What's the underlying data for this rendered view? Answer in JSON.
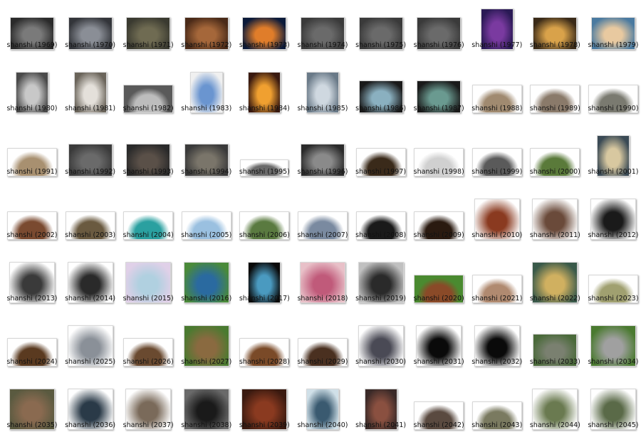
{
  "items": [
    {
      "label": "shanshi (1969)",
      "icon": "dark-rock-thumbnail-icon",
      "colors": [
        "#7a7a7a",
        "#2a2a2a"
      ],
      "shape": "landscape"
    },
    {
      "label": "shanshi (1970)",
      "icon": "crystal-rocks-thumbnail-icon",
      "colors": [
        "#8a8e96",
        "#33353a"
      ],
      "shape": "landscape"
    },
    {
      "label": "shanshi (1971)",
      "icon": "mossy-rock-thumbnail-icon",
      "colors": [
        "#6f6b52",
        "#3a3a30"
      ],
      "shape": "landscape"
    },
    {
      "label": "shanshi (1972)",
      "icon": "red-cliff-thumbnail-icon",
      "colors": [
        "#a5673a",
        "#4a2a18"
      ],
      "shape": "landscape"
    },
    {
      "label": "shanshi (1973)",
      "icon": "glowing-rock-thumbnail-icon",
      "colors": [
        "#e07d2a",
        "#0b1a3a"
      ],
      "shape": "landscape"
    },
    {
      "label": "shanshi (1974)",
      "icon": "grey-stones-thumbnail-icon",
      "colors": [
        "#6a6a6a",
        "#3a3a3a"
      ],
      "shape": "landscape"
    },
    {
      "label": "shanshi (1975)",
      "icon": "grey-stones-thumbnail-icon",
      "colors": [
        "#6a6a6a",
        "#3a3a3a"
      ],
      "shape": "landscape"
    },
    {
      "label": "shanshi (1976)",
      "icon": "grey-stones-thumbnail-icon",
      "colors": [
        "#6a6a6a",
        "#3a3a3a"
      ],
      "shape": "landscape"
    },
    {
      "label": "shanshi (1977)",
      "icon": "purple-cave-thumbnail-icon",
      "colors": [
        "#7a3aa0",
        "#2a1a55"
      ],
      "shape": "portrait"
    },
    {
      "label": "shanshi (1978)",
      "icon": "golden-cave-thumbnail-icon",
      "colors": [
        "#d9a24a",
        "#3a2a18"
      ],
      "shape": "landscape"
    },
    {
      "label": "shanshi (1979)",
      "icon": "coast-rock-thumbnail-icon",
      "colors": [
        "#e8c9a0",
        "#4a7aa0"
      ],
      "shape": "landscape"
    },
    {
      "label": "shanshi (1980)",
      "icon": "misty-peak-thumbnail-icon",
      "colors": [
        "#c8c8c8",
        "#4a4a4a"
      ],
      "shape": "portrait"
    },
    {
      "label": "shanshi (1981)",
      "icon": "misty-peak-thumbnail-icon",
      "colors": [
        "#e4e0da",
        "#6a645a"
      ],
      "shape": "portrait"
    },
    {
      "label": "shanshi (1982)",
      "icon": "white-rock-thumbnail-icon",
      "colors": [
        "#bdbdbd",
        "#5a5a5a"
      ],
      "shape": "cutout"
    },
    {
      "label": "shanshi (1983)",
      "icon": "snow-spire-thumbnail-icon",
      "colors": [
        "#6a95d0",
        "#f0f0f0"
      ],
      "shape": "portrait"
    },
    {
      "label": "shanshi (1984)",
      "icon": "sunset-cliff-thumbnail-icon",
      "colors": [
        "#f0a030",
        "#3a1a10"
      ],
      "shape": "portrait"
    },
    {
      "label": "shanshi (1985)",
      "icon": "sea-cliff-thumbnail-icon",
      "colors": [
        "#cfd8e0",
        "#6a7a88"
      ],
      "shape": "portrait"
    },
    {
      "label": "shanshi (1986)",
      "icon": "blue-boulder-thumbnail-icon",
      "colors": [
        "#8ab0c0",
        "#1a1a1a"
      ],
      "shape": "landscape"
    },
    {
      "label": "shanshi (1987)",
      "icon": "teal-boulder-thumbnail-icon",
      "colors": [
        "#6a9a90",
        "#1a1a1a"
      ],
      "shape": "landscape"
    },
    {
      "label": "shanshi (1988)",
      "icon": "flat-rock-thumbnail-icon",
      "colors": [
        "#a08a70",
        "#ffffff"
      ],
      "shape": "cutout"
    },
    {
      "label": "shanshi (1989)",
      "icon": "flat-rock-thumbnail-icon",
      "colors": [
        "#8a7a6a",
        "#ffffff"
      ],
      "shape": "cutout"
    },
    {
      "label": "shanshi (1990)",
      "icon": "flat-rock-thumbnail-icon",
      "colors": [
        "#7a7a70",
        "#ffffff"
      ],
      "shape": "cutout"
    },
    {
      "label": "shanshi (1991)",
      "icon": "layered-rock-thumbnail-icon",
      "colors": [
        "#a89070",
        "#ffffff"
      ],
      "shape": "cutout"
    },
    {
      "label": "shanshi (1992)",
      "icon": "grey-arch-thumbnail-icon",
      "colors": [
        "#6a6a6a",
        "#3a3a3a"
      ],
      "shape": "landscape"
    },
    {
      "label": "shanshi (1993)",
      "icon": "stone-pillar-thumbnail-icon",
      "colors": [
        "#5a5048",
        "#2a2a2a"
      ],
      "shape": "landscape"
    },
    {
      "label": "shanshi (1994)",
      "icon": "stone-pillar-thumbnail-icon",
      "colors": [
        "#7a756a",
        "#3a3a3a"
      ],
      "shape": "landscape"
    },
    {
      "label": "shanshi (1995)",
      "icon": "pebble-row-thumbnail-icon",
      "colors": [
        "#6a6a6a",
        "#ffffff"
      ],
      "shape": "strip"
    },
    {
      "label": "shanshi (1996)",
      "icon": "grey-boulders-thumbnail-icon",
      "colors": [
        "#8a8a8a",
        "#2a2a2a"
      ],
      "shape": "landscape"
    },
    {
      "label": "shanshi (1997)",
      "icon": "cliff-edge-thumbnail-icon",
      "colors": [
        "#3a2a1a",
        "#ffffff"
      ],
      "shape": "cutout"
    },
    {
      "label": "shanshi (1998)",
      "icon": "white-pebbles-thumbnail-icon",
      "colors": [
        "#d0d0d0",
        "#ffffff"
      ],
      "shape": "cutout"
    },
    {
      "label": "shanshi (1999)",
      "icon": "small-rock-thumbnail-icon",
      "colors": [
        "#5a5a5a",
        "#ffffff"
      ],
      "shape": "cutout"
    },
    {
      "label": "shanshi (2000)",
      "icon": "grass-rock-thumbnail-icon",
      "colors": [
        "#5a7a3a",
        "#ffffff"
      ],
      "shape": "cutout"
    },
    {
      "label": "shanshi (2001)",
      "icon": "lake-rock-thumbnail-icon",
      "colors": [
        "#d8c8a0",
        "#3a4a55"
      ],
      "shape": "portrait"
    },
    {
      "label": "shanshi (2002)",
      "icon": "spiky-ridge-thumbnail-icon",
      "colors": [
        "#7a4a30",
        "#ffffff"
      ],
      "shape": "cutout"
    },
    {
      "label": "shanshi (2003)",
      "icon": "earth-bank-thumbnail-icon",
      "colors": [
        "#6a5a40",
        "#ffffff"
      ],
      "shape": "cutout"
    },
    {
      "label": "shanshi (2004)",
      "icon": "pond-rock-thumbnail-icon",
      "colors": [
        "#2aa0a0",
        "#ffffff"
      ],
      "shape": "cutout"
    },
    {
      "label": "shanshi (2005)",
      "icon": "smooth-stones-thumbnail-icon",
      "colors": [
        "#9ac0e0",
        "#ffffff"
      ],
      "shape": "cutout"
    },
    {
      "label": "shanshi (2006)",
      "icon": "green-hill-thumbnail-icon",
      "colors": [
        "#5a7a40",
        "#ffffff"
      ],
      "shape": "cutout"
    },
    {
      "label": "shanshi (2007)",
      "icon": "mountain-range-thumbnail-icon",
      "colors": [
        "#7a8aa0",
        "#ffffff"
      ],
      "shape": "cutout"
    },
    {
      "label": "shanshi (2008)",
      "icon": "dark-silhouette-thumbnail-icon",
      "colors": [
        "#1a1a1a",
        "#ffffff"
      ],
      "shape": "cutout"
    },
    {
      "label": "shanshi (2009)",
      "icon": "dark-silhouette-thumbnail-icon",
      "colors": [
        "#2a1a10",
        "#ffffff"
      ],
      "shape": "cutout"
    },
    {
      "label": "shanshi (2010)",
      "icon": "flying-debris-thumbnail-icon",
      "colors": [
        "#8a3a20",
        "#ffffff"
      ],
      "shape": "square"
    },
    {
      "label": "shanshi (2011)",
      "icon": "flying-debris-thumbnail-icon",
      "colors": [
        "#6a4a3a",
        "#ffffff"
      ],
      "shape": "square"
    },
    {
      "label": "shanshi (2012)",
      "icon": "flying-debris-thumbnail-icon",
      "colors": [
        "#1a1a1a",
        "#ffffff"
      ],
      "shape": "square"
    },
    {
      "label": "shanshi (2013)",
      "icon": "flying-debris-thumbnail-icon",
      "colors": [
        "#3a3a3a",
        "#ffffff"
      ],
      "shape": "square"
    },
    {
      "label": "shanshi (2014)",
      "icon": "flying-debris-thumbnail-icon",
      "colors": [
        "#2a2a2a",
        "#ffffff"
      ],
      "shape": "square"
    },
    {
      "label": "shanshi (2015)",
      "icon": "opal-gem-thumbnail-icon",
      "colors": [
        "#b0d0e0",
        "#e0d0e8"
      ],
      "shape": "square"
    },
    {
      "label": "shanshi (2016)",
      "icon": "blue-crystal-thumbnail-icon",
      "colors": [
        "#2a6aa0",
        "#4a8a3a"
      ],
      "shape": "square"
    },
    {
      "label": "shanshi (2017)",
      "icon": "earth-stone-thumbnail-icon",
      "colors": [
        "#4a9ac0",
        "#0a0a0a"
      ],
      "shape": "portrait"
    },
    {
      "label": "shanshi (2018)",
      "icon": "pink-sphere-thumbnail-icon",
      "colors": [
        "#c05a7a",
        "#e8c0c8"
      ],
      "shape": "square"
    },
    {
      "label": "shanshi (2019)",
      "icon": "black-sphere-thumbnail-icon",
      "colors": [
        "#2a2a2a",
        "#c0c0c0"
      ],
      "shape": "square"
    },
    {
      "label": "shanshi (2020)",
      "icon": "floating-island-thumbnail-icon",
      "colors": [
        "#8a4a28",
        "#4a8a30"
      ],
      "shape": "cutout"
    },
    {
      "label": "shanshi (2021)",
      "icon": "rock-ledge-thumbnail-icon",
      "colors": [
        "#b08a70",
        "#ffffff"
      ],
      "shape": "cutout"
    },
    {
      "label": "shanshi (2022)",
      "icon": "sky-rock-thumbnail-icon",
      "colors": [
        "#d0b060",
        "#3a5a4a"
      ],
      "shape": "square"
    },
    {
      "label": "shanshi (2023)",
      "icon": "moss-stone-thumbnail-icon",
      "colors": [
        "#a0a070",
        "#ffffff"
      ],
      "shape": "cutout"
    },
    {
      "label": "shanshi (2024)",
      "icon": "driftwood-rock-thumbnail-icon",
      "colors": [
        "#5a3a20",
        "#ffffff"
      ],
      "shape": "cutout"
    },
    {
      "label": "shanshi (2025)",
      "icon": "grey-boulder-thumbnail-icon",
      "colors": [
        "#8a9098",
        "#ffffff"
      ],
      "shape": "square"
    },
    {
      "label": "shanshi (2026)",
      "icon": "cliff-edge-thumbnail-icon",
      "colors": [
        "#6a4a30",
        "#ffffff"
      ],
      "shape": "cutout"
    },
    {
      "label": "shanshi (2027)",
      "icon": "tree-rock-thumbnail-icon",
      "colors": [
        "#8a6a40",
        "#4a7a30"
      ],
      "shape": "square"
    },
    {
      "label": "shanshi (2028)",
      "icon": "rock-arch-thumbnail-icon",
      "colors": [
        "#7a4a28",
        "#ffffff"
      ],
      "shape": "cutout"
    },
    {
      "label": "shanshi (2029)",
      "icon": "brown-rock-thumbnail-icon",
      "colors": [
        "#4a3020",
        "#ffffff"
      ],
      "shape": "cutout"
    },
    {
      "label": "shanshi (2030)",
      "icon": "slate-rock-thumbnail-icon",
      "colors": [
        "#4a4a55",
        "#ffffff"
      ],
      "shape": "square"
    },
    {
      "label": "shanshi (2031)",
      "icon": "flying-debris-thumbnail-icon",
      "colors": [
        "#0a0a0a",
        "#ffffff"
      ],
      "shape": "square"
    },
    {
      "label": "shanshi (2032)",
      "icon": "flying-debris-thumbnail-icon",
      "colors": [
        "#0a0a0a",
        "#ffffff"
      ],
      "shape": "square"
    },
    {
      "label": "shanshi (2033)",
      "icon": "stone-wall-thumbnail-icon",
      "colors": [
        "#7a8070",
        "#4a6a3a"
      ],
      "shape": "landscape"
    },
    {
      "label": "shanshi (2034)",
      "icon": "grey-boulder-thumbnail-icon",
      "colors": [
        "#a0a0a0",
        "#4a7a30"
      ],
      "shape": "square"
    },
    {
      "label": "shanshi (2035)",
      "icon": "canyon-cliff-thumbnail-icon",
      "colors": [
        "#8a6a50",
        "#5a5a40"
      ],
      "shape": "square"
    },
    {
      "label": "shanshi (2036)",
      "icon": "dark-cliff-thumbnail-icon",
      "colors": [
        "#2a3a48",
        "#ffffff"
      ],
      "shape": "square"
    },
    {
      "label": "shanshi (2037)",
      "icon": "large-rock-thumbnail-icon",
      "colors": [
        "#7a6a5a",
        "#ffffff"
      ],
      "shape": "square"
    },
    {
      "label": "shanshi (2038)",
      "icon": "black-crystal-thumbnail-icon",
      "colors": [
        "#1a1a1a",
        "#6a6a6a"
      ],
      "shape": "square"
    },
    {
      "label": "shanshi (2039)",
      "icon": "rust-stone-thumbnail-icon",
      "colors": [
        "#8a3a20",
        "#3a1a10"
      ],
      "shape": "square"
    },
    {
      "label": "shanshi (2040)",
      "icon": "waterfall-thumbnail-icon",
      "colors": [
        "#3a5a70",
        "#d0e0e8"
      ],
      "shape": "portrait"
    },
    {
      "label": "shanshi (2041)",
      "icon": "canyon-wall-thumbnail-icon",
      "colors": [
        "#8a5040",
        "#3a2a28"
      ],
      "shape": "portrait"
    },
    {
      "label": "shanshi (2042)",
      "icon": "dark-rock-thumbnail-icon",
      "colors": [
        "#5a4a40",
        "#ffffff"
      ],
      "shape": "cutout"
    },
    {
      "label": "shanshi (2043)",
      "icon": "mossy-rocks-thumbnail-icon",
      "colors": [
        "#7a7a60",
        "#ffffff"
      ],
      "shape": "cutout"
    },
    {
      "label": "shanshi (2044)",
      "icon": "mossy-boulder-thumbnail-icon",
      "colors": [
        "#6a7a50",
        "#ffffff"
      ],
      "shape": "square"
    },
    {
      "label": "shanshi (2045)",
      "icon": "mossy-boulder-thumbnail-icon",
      "colors": [
        "#5a6a48",
        "#ffffff"
      ],
      "shape": "square"
    }
  ]
}
